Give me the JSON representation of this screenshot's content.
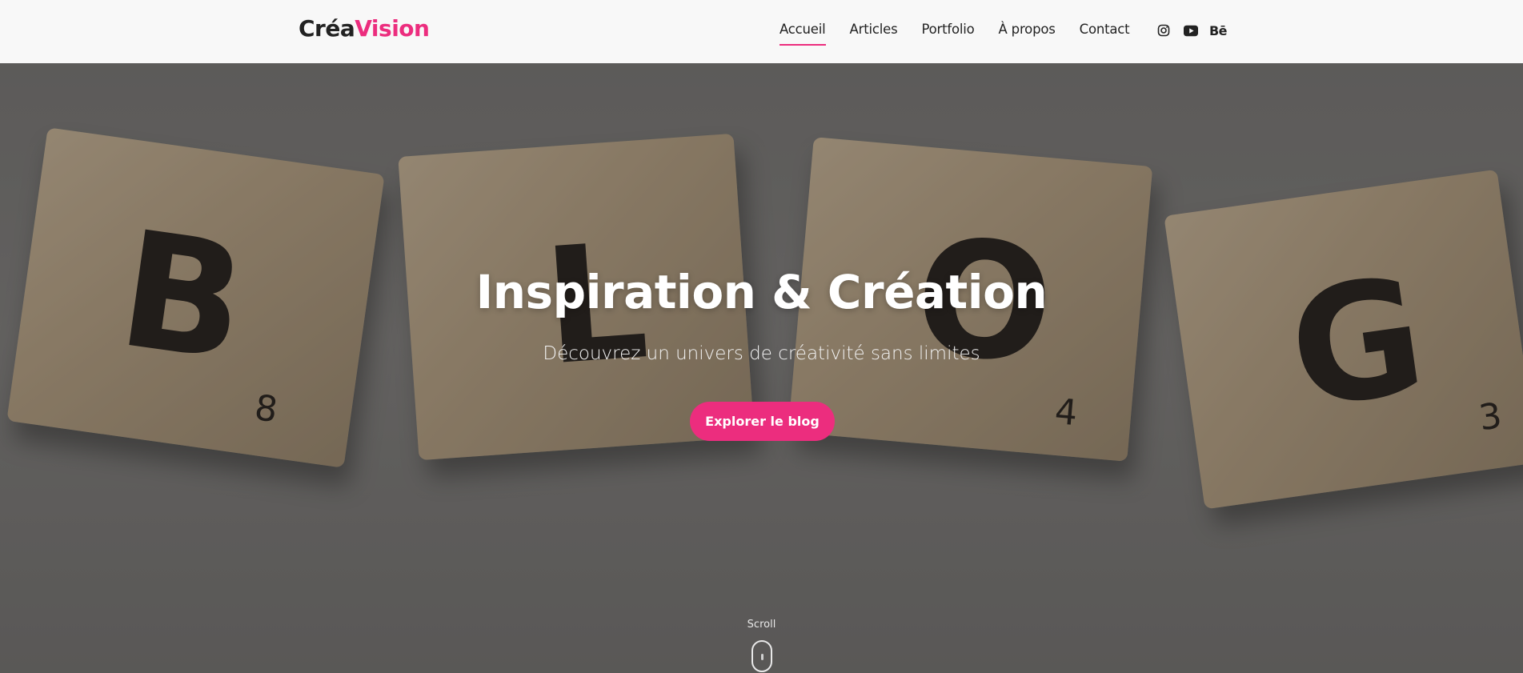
{
  "brand": {
    "prefix": "Créa",
    "accent": "Vision",
    "accent_color": "#ec2d7e"
  },
  "nav": {
    "items": [
      {
        "label": "Accueil",
        "active": true
      },
      {
        "label": "Articles",
        "active": false
      },
      {
        "label": "Portfolio",
        "active": false
      },
      {
        "label": "À propos",
        "active": false
      },
      {
        "label": "Contact",
        "active": false
      }
    ]
  },
  "social": {
    "icons": [
      "instagram-icon",
      "youtube-icon",
      "behance-icon"
    ],
    "behance_label": "Bē"
  },
  "hero": {
    "title": "Inspiration & Création",
    "subtitle": "Découvrez un univers de créativité sans limites",
    "cta_label": "Explorer le blog",
    "tiles": [
      {
        "letter": "B",
        "number": "8"
      },
      {
        "letter": "L",
        "number": ""
      },
      {
        "letter": "O",
        "number": "4"
      },
      {
        "letter": "G",
        "number": "3"
      }
    ]
  },
  "scroll": {
    "label": "Scroll"
  }
}
